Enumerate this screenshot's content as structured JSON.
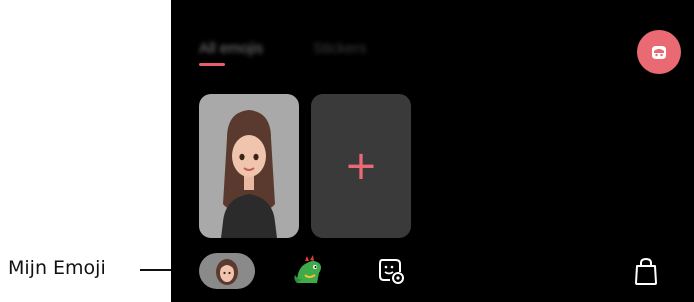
{
  "callout": {
    "label": "Mijn Emoji"
  },
  "tabs": [
    {
      "label": "All emojis",
      "active": true
    },
    {
      "label": "Stickers",
      "active": false
    }
  ],
  "accent_color": "#e85d6a",
  "icons": {
    "fab": "avatar-camera-icon",
    "add": "plus-icon",
    "bottom": [
      "my-emoji-avatar-icon",
      "dino-emoji-icon",
      "sticker-settings-icon",
      "shopping-bag-icon"
    ]
  },
  "add_symbol": "+"
}
